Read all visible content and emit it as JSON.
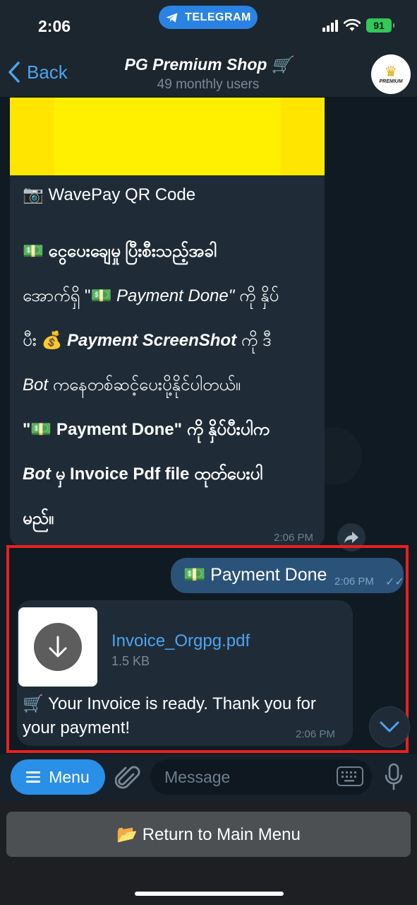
{
  "status_bar": {
    "time": "2:06",
    "app_pill": "TELEGRAM",
    "battery": "91"
  },
  "header": {
    "back_label": "Back",
    "title": "PG Premium Shop 🛒",
    "subtitle": "49 monthly users",
    "avatar_text": "PREMIUM"
  },
  "messages": {
    "incoming_1": {
      "caption_title": "📷 WavePay QR Code",
      "line1": "💵 ငွေပေးချေမှု ပြီးစီးသည့်အခါ",
      "line2_a": "အောက်ရှိ \"💵 ",
      "line2_b": "Payment Done\"",
      "line2_c": " ကို နှိပ်",
      "line3_a": "ပီး 💰 ",
      "line3_b": "Payment ScreenShot",
      "line3_c": " ကို ဒီ",
      "line4_a": "Bot",
      "line4_b": " ကနေတစ်ဆင့်ပေးပို့နိုင်ပါတယ်။",
      "line5": "\"💵 Payment Done\" ကို နှိပ်ပီးပါက",
      "line6_a": "Bot",
      "line6_b": " မှ Invoice Pdf file ထုတ်ပေးပါ",
      "line7": "မည်။",
      "time": "2:06 PM"
    },
    "outgoing_1": {
      "text": "💵 Payment Done",
      "time": "2:06 PM"
    },
    "file_message": {
      "file_name": "Invoice_Orgpg.pdf",
      "file_size": "1.5 KB",
      "caption": "🛒 Your Invoice is ready. Thank you for your payment!",
      "time": "2:06 PM"
    }
  },
  "input_bar": {
    "menu_label": "Menu",
    "placeholder": "Message"
  },
  "keyboard": {
    "main_menu_button": "📂 Return to Main Menu"
  },
  "colors": {
    "accent": "#2a8fe6",
    "link": "#4fa3ee",
    "highlight_border": "#e8201f",
    "outgoing_bubble": "#2b5278",
    "incoming_bubble": "#1f2c38"
  }
}
